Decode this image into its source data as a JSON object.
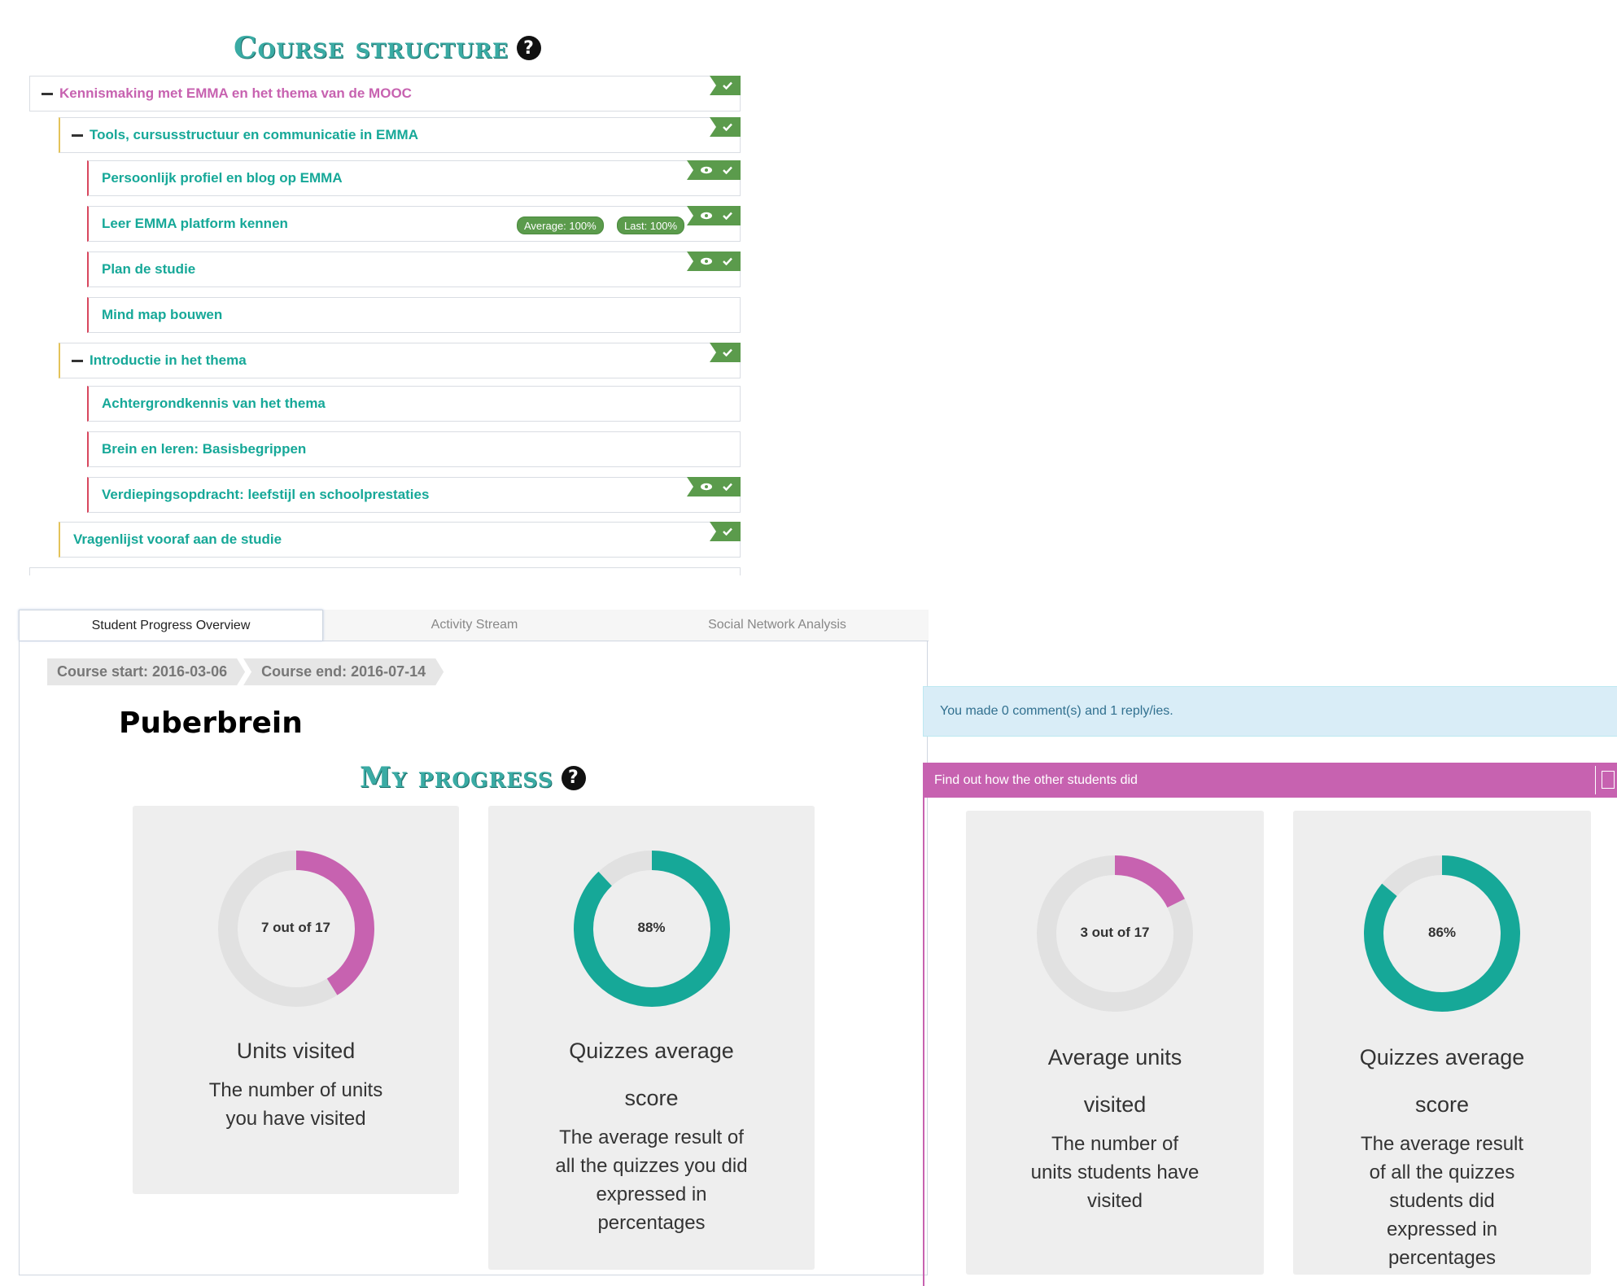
{
  "course_structure": {
    "title": "Course structure",
    "rows": [
      {
        "label": "Kennismaking met EMMA en het thema van de MOOC"
      },
      {
        "label": "Tools, cursusstructuur en communicatie in EMMA"
      },
      {
        "label": "Persoonlijk profiel en blog op EMMA"
      },
      {
        "label": "Leer EMMA platform kennen",
        "badge_average": "Average: 100%",
        "badge_last": "Last: 100%"
      },
      {
        "label": "Plan de studie"
      },
      {
        "label": "Mind map bouwen"
      },
      {
        "label": "Introductie in het thema"
      },
      {
        "label": "Achtergrondkennis van het thema"
      },
      {
        "label": "Brein en leren: Basisbegrippen"
      },
      {
        "label": "Verdiepingsopdracht: leefstijl en schoolprestaties"
      },
      {
        "label": "Vragenlijst vooraf aan de studie"
      }
    ]
  },
  "tabs": [
    {
      "label": "Student Progress Overview",
      "active": true
    },
    {
      "label": "Activity Stream"
    },
    {
      "label": "Social Network Analysis"
    }
  ],
  "breadcrumb": {
    "start": "Course start: 2016-03-06",
    "end": "Course end: 2016-07-14"
  },
  "course_title": "Puberbrein",
  "my_progress": {
    "title": "My progress",
    "units": {
      "value_label": "7 out of 17",
      "value": 7,
      "total": 17,
      "title": "Units visited",
      "desc_1": "The number of units",
      "desc_2": "you have visited"
    },
    "quizzes": {
      "value_label": "88%",
      "value": 88,
      "title_1": "Quizzes average",
      "title_2": "score",
      "desc_1": "The average result of",
      "desc_2": "all the quizzes you did",
      "desc_3": "expressed in",
      "desc_4": "percentages"
    }
  },
  "comments_info": "You made 0 comment(s) and 1 reply/ies.",
  "others": {
    "bar_label": "Find out how the other students did",
    "units": {
      "value_label": "3 out of 17",
      "value": 3,
      "total": 17,
      "title_1": "Average units",
      "title_2": "visited",
      "desc_1": "The number of",
      "desc_2": "units students have",
      "desc_3": "visited"
    },
    "quizzes": {
      "value_label": "86%",
      "value": 86,
      "title_1": "Quizzes average",
      "title_2": "score",
      "desc_1": "The average result",
      "desc_2": "of all the quizzes",
      "desc_3": "students did",
      "desc_4": "expressed in",
      "desc_5": "percentages"
    }
  },
  "colors": {
    "teal": "#16a898",
    "pink": "#c762b0",
    "green_flag": "#5b9b4c",
    "donut_track": "#e1e1e1"
  }
}
